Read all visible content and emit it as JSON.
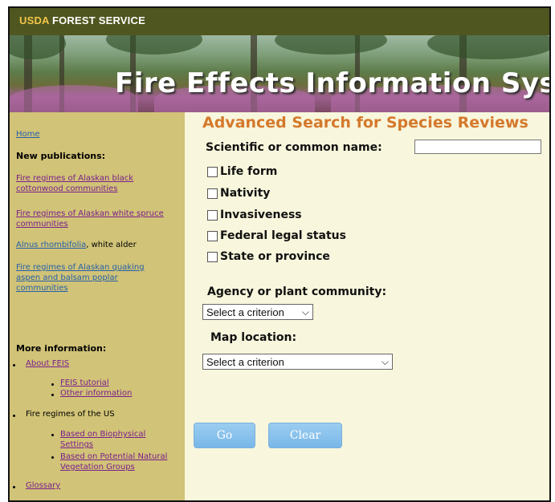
{
  "header": {
    "brand": "USDA",
    "brand_suffix": " FOREST SERVICE",
    "banner_title": "Fire Effects Information System"
  },
  "sidebar": {
    "home": "Home",
    "new_pubs_heading": "New publications:",
    "pub1": "Fire regimes of Alaskan black cottonwood communities",
    "pub2": "Fire regimes of Alaskan white spruce communities",
    "pub3_link": "Alnus rhombifolia",
    "pub3_rest": ", white alder",
    "pub4": "Fire regimes of Alaskan quaking aspen and balsam poplar communities",
    "more_heading": "More information:",
    "about": "About FEIS",
    "tutorial": "FEIS tutorial",
    "other_info": "Other information",
    "fire_regimes": "Fire regimes of the US",
    "biophysical": "Based on Biophysical Settings",
    "pnv": "Based on Potential Natural Vegetation Groups",
    "glossary": "Glossary"
  },
  "main": {
    "title": "Advanced Search for Species Reviews",
    "name_label": "Scientific or common name:",
    "name_value": "",
    "checks": [
      "Life form",
      "Nativity",
      "Invasiveness",
      "Federal legal status",
      "State or province"
    ],
    "agency_label": "Agency or plant community:",
    "agency_select": "Select a criterion",
    "map_label": "Map location:",
    "map_select": "Select a criterion",
    "go": "Go",
    "clear": "Clear"
  }
}
